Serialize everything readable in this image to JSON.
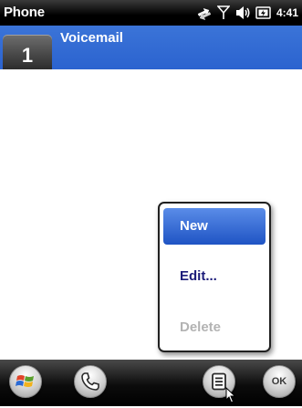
{
  "status_bar": {
    "title": "Phone",
    "time": "4:41",
    "icons": [
      "data-connection-icon",
      "signal-strength-icon",
      "volume-icon",
      "battery-icon"
    ]
  },
  "header": {
    "speed_dial_number": "1",
    "name": "Voicemail",
    "color": "#2f68d2"
  },
  "context_menu": {
    "items": [
      {
        "label": "New",
        "state": "selected"
      },
      {
        "label": "Edit...",
        "state": "normal"
      },
      {
        "label": "Delete",
        "state": "disabled"
      }
    ]
  },
  "softkeys": {
    "ok_label": "OK",
    "icons": [
      "windows-start-icon",
      "phone-handset-icon",
      "menu-list-icon",
      "ok-icon"
    ]
  },
  "colors": {
    "accent": "#2f68d2",
    "selected_item": "#2a5fd0",
    "disabled_text": "#b3b3b3",
    "menu_text": "#1c1c7a"
  }
}
